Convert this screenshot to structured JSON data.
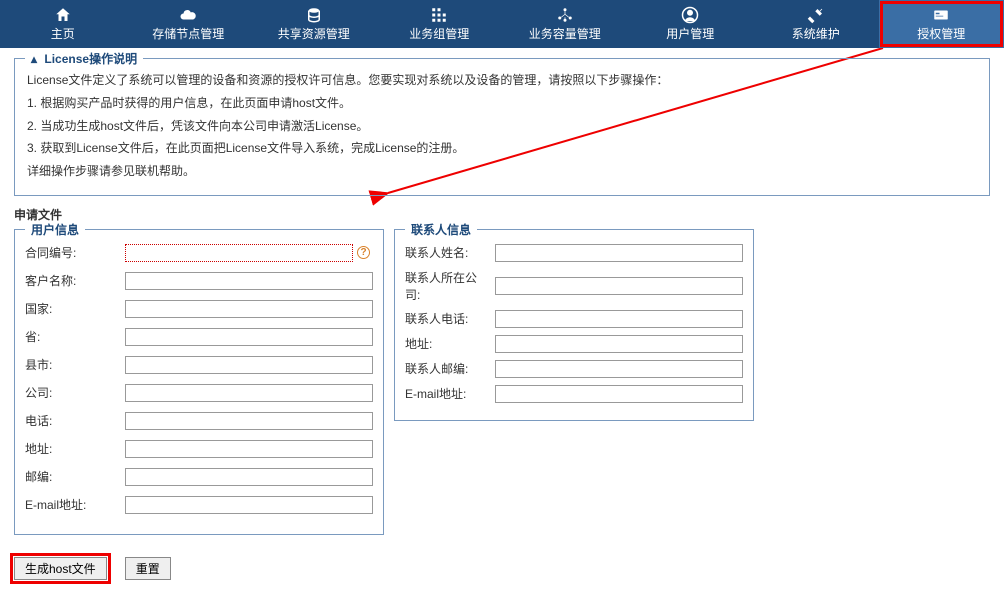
{
  "nav": {
    "items": [
      {
        "label": "主页"
      },
      {
        "label": "存储节点管理"
      },
      {
        "label": "共享资源管理"
      },
      {
        "label": "业务组管理"
      },
      {
        "label": "业务容量管理"
      },
      {
        "label": "用户管理"
      },
      {
        "label": "系统维护"
      },
      {
        "label": "授权管理"
      }
    ]
  },
  "license_box": {
    "legend": "License操作说明",
    "line1": "License文件定义了系统可以管理的设备和资源的授权许可信息。您要实现对系统以及设备的管理，请按照以下步骤操作：",
    "line2": "1. 根据购买产品时获得的用户信息，在此页面申请host文件。",
    "line3": "2. 当成功生成host文件后，凭该文件向本公司申请激活License。",
    "line4": "3. 获取到License文件后，在此页面把License文件导入系统，完成License的注册。",
    "line5": "详细操作步骤请参见联机帮助。"
  },
  "section_title": "申请文件",
  "user_form": {
    "legend": "用户信息",
    "contract_no": {
      "label": "合同编号:",
      "value": ""
    },
    "customer_name": {
      "label": "客户名称:",
      "value": ""
    },
    "country": {
      "label": "国家:",
      "value": ""
    },
    "province": {
      "label": "省:",
      "value": ""
    },
    "city": {
      "label": "县市:",
      "value": ""
    },
    "company": {
      "label": "公司:",
      "value": ""
    },
    "phone": {
      "label": "电话:",
      "value": ""
    },
    "address": {
      "label": "地址:",
      "value": ""
    },
    "zip": {
      "label": "邮编:",
      "value": ""
    },
    "email": {
      "label": "E-mail地址:",
      "value": ""
    }
  },
  "contact_form": {
    "legend": "联系人信息",
    "name": {
      "label": "联系人姓名:",
      "value": ""
    },
    "company": {
      "label": "联系人所在公司:",
      "value": ""
    },
    "phone": {
      "label": "联系人电话:",
      "value": ""
    },
    "address": {
      "label": "地址:",
      "value": ""
    },
    "zip": {
      "label": "联系人邮编:",
      "value": ""
    },
    "email": {
      "label": "E-mail地址:",
      "value": ""
    }
  },
  "buttons": {
    "gen_host": "生成host文件",
    "reset": "重置"
  }
}
